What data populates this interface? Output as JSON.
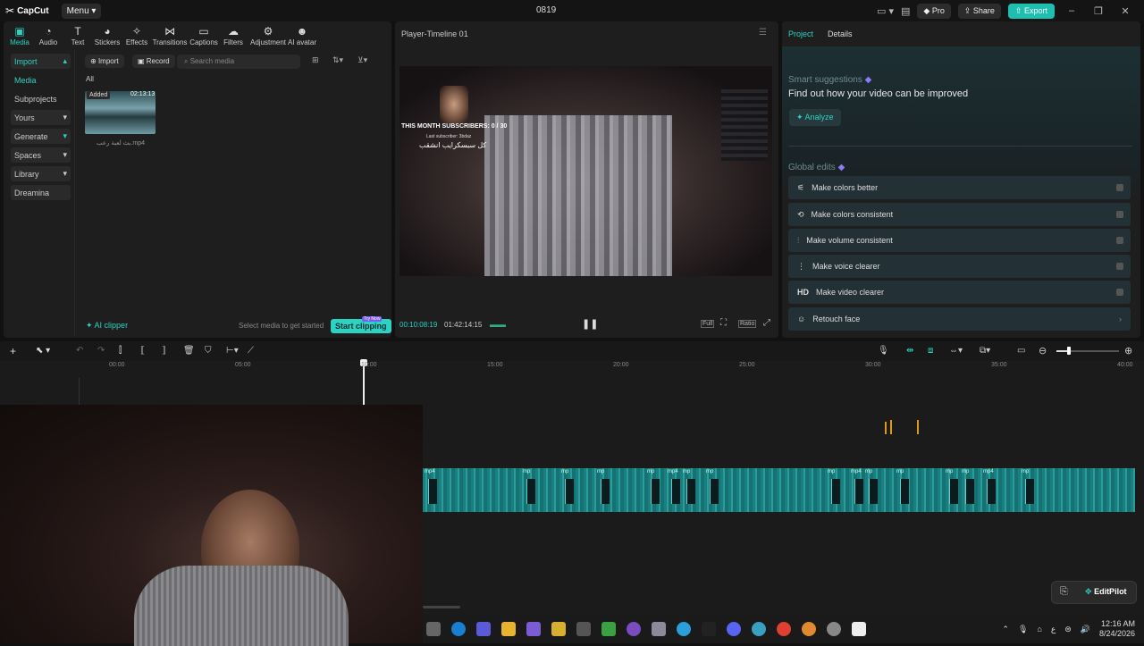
{
  "titlebar": {
    "app_name": "CapCut",
    "menu_label": "Menu",
    "project_title": "0819",
    "pro_label": "Pro",
    "share_label": "Share",
    "export_label": "Export"
  },
  "toolbar": {
    "items": [
      {
        "label": "Media",
        "icon": "media-icon",
        "active": true
      },
      {
        "label": "Audio",
        "icon": "audio-icon"
      },
      {
        "label": "Text",
        "icon": "text-icon"
      },
      {
        "label": "Stickers",
        "icon": "stickers-icon"
      },
      {
        "label": "Effects",
        "icon": "effects-icon"
      },
      {
        "label": "Transitions",
        "icon": "transitions-icon"
      },
      {
        "label": "Captions",
        "icon": "captions-icon"
      },
      {
        "label": "Filters",
        "icon": "filters-icon"
      },
      {
        "label": "Adjustment",
        "icon": "adjustment-icon"
      },
      {
        "label": "AI avatar",
        "icon": "ai-avatar-icon"
      }
    ]
  },
  "sidebar": {
    "items": [
      {
        "label": "Import"
      },
      {
        "label": "Media"
      },
      {
        "label": "Subprojects"
      },
      {
        "label": "Yours"
      },
      {
        "label": "Generate"
      },
      {
        "label": "Spaces"
      },
      {
        "label": "Library"
      },
      {
        "label": "Dreamina"
      }
    ]
  },
  "media": {
    "import_label": "Import",
    "record_label": "Record",
    "search_placeholder": "Search media",
    "filter_all": "All",
    "clip": {
      "badge": "Added",
      "duration": "02:13:13",
      "name": "بث لعبة رعب.mp4"
    },
    "ai_clipper_label": "AI clipper",
    "select_hint": "Select media to get started",
    "start_clipping_label": "Start clipping",
    "try_now_badge": "Try Now"
  },
  "player": {
    "title": "Player-Timeline 01",
    "overlay_subs": "THIS MONTH SUBSCRIBERS: 0 / 30",
    "overlay_last": "Last subscriber: 3bdaz",
    "overlay_arabic": "كل سبسكرايب انشقب",
    "current_time": "00:10:08:19",
    "total_time": "01:42:14:15",
    "full_label": "Full",
    "ratio_label": "Ratio"
  },
  "right_panel": {
    "tab_project": "Project",
    "tab_details": "Details",
    "smart_title": "Smart suggestions",
    "smart_sub": "Find out how your video can be improved",
    "analyze_label": "Analyze",
    "global_title": "Global edits",
    "global_items": [
      {
        "label": "Make colors better"
      },
      {
        "label": "Make colors consistent"
      },
      {
        "label": "Make volume consistent"
      },
      {
        "label": "Make voice clearer"
      },
      {
        "label": "Make video clearer",
        "icon_text": "HD"
      },
      {
        "label": "Retouch face"
      }
    ]
  },
  "timeline": {
    "ruler": [
      "00:00",
      "05:00",
      "10:00",
      "15:00",
      "20:00",
      "25:00",
      "30:00",
      "35:00",
      "40:00"
    ],
    "clip_labels": [
      "mp4",
      "mp",
      "mp",
      "mp",
      "mp",
      "mp4",
      "mp",
      "mp",
      "mp",
      "mp4",
      "mp",
      "mp",
      "mp",
      "mp",
      "mp4",
      "mp"
    ]
  },
  "editpilot_label": "EditPilot",
  "taskbar": {
    "time": "12:16 AM",
    "date": "8/24/2026",
    "lang": "ع"
  },
  "colors": {
    "accent": "#2cd3c3",
    "export": "#1fbfb0",
    "clip": "#1a8a8a"
  }
}
